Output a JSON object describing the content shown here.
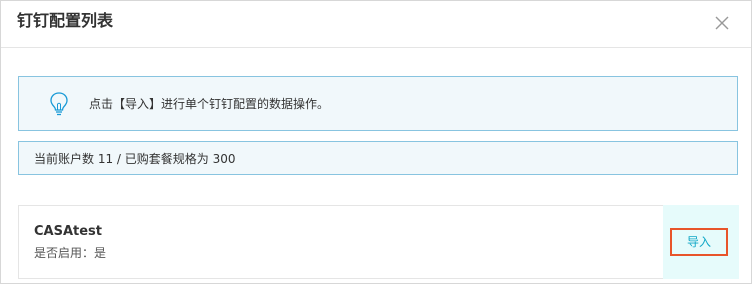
{
  "dialog": {
    "title": "钉钉配置列表",
    "close_icon": "close-icon"
  },
  "tip": {
    "icon": "lightbulb-icon",
    "text": "点击【导入】进行单个钉钉配置的数据操作。"
  },
  "account_count": {
    "text": "当前账户数 11 / 已购套餐规格为 300"
  },
  "configs": [
    {
      "name": "CASAtest",
      "status_text": "是否启用：是",
      "action_label": "导入"
    }
  ],
  "colors": {
    "tip_border": "#88c4e0",
    "tip_background": "#f1f8fb",
    "action_background": "#e6fbfb",
    "action_text": "#12a8c7",
    "highlight_border": "#e8542a"
  }
}
